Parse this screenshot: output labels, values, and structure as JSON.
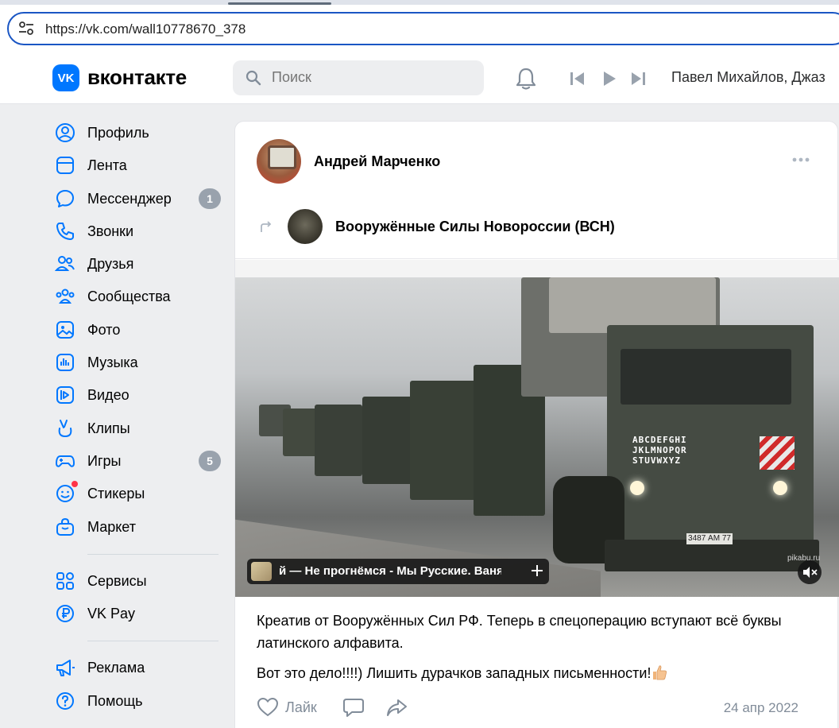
{
  "browser": {
    "url": "https://vk.com/wall10778670_378"
  },
  "header": {
    "logo_text": "VK",
    "brand": "вконтакте",
    "search_placeholder": "Поиск",
    "now_playing": "Павел Михайлов, Джаз"
  },
  "sidebar": {
    "items": [
      {
        "label": "Профиль",
        "icon": "profile-icon"
      },
      {
        "label": "Лента",
        "icon": "feed-icon"
      },
      {
        "label": "Мессенджер",
        "icon": "messenger-icon",
        "badge": "1"
      },
      {
        "label": "Звонки",
        "icon": "phone-icon"
      },
      {
        "label": "Друзья",
        "icon": "friends-icon"
      },
      {
        "label": "Сообщества",
        "icon": "communities-icon"
      },
      {
        "label": "Фото",
        "icon": "photo-icon"
      },
      {
        "label": "Музыка",
        "icon": "music-icon"
      },
      {
        "label": "Видео",
        "icon": "video-icon"
      },
      {
        "label": "Клипы",
        "icon": "clips-icon"
      },
      {
        "label": "Игры",
        "icon": "games-icon",
        "badge": "5"
      },
      {
        "label": "Стикеры",
        "icon": "stickers-icon"
      },
      {
        "label": "Маркет",
        "icon": "market-icon"
      }
    ],
    "extra": [
      {
        "label": "Сервисы",
        "icon": "services-icon"
      },
      {
        "label": "VK Pay",
        "icon": "vkpay-icon"
      }
    ],
    "bottom": [
      {
        "label": "Реклама",
        "icon": "ads-icon"
      },
      {
        "label": "Помощь",
        "icon": "help-icon"
      }
    ]
  },
  "post": {
    "author": "Андрей Марченко",
    "repost_group": "Вооружённые Силы Новороссии (ВСН)",
    "truck_letters": [
      "ABCDEFGHI",
      "JKLMNOPQR",
      "STUVWXYZ"
    ],
    "plate": "3487 АМ 77",
    "watermark": "pikabu.ru",
    "audio_title": "й — Не прогнёмся - Мы Русские.   Ваня",
    "text_1": "Креатив от Вооружённых Сил РФ. Теперь в спецоперацию вступают всё буквы латинского алфавита.",
    "text_2": "Вот это дело!!!!) Лишить дурачков западных письменности!",
    "like_label": "Лайк",
    "date": "24 апр 2022"
  },
  "colors": {
    "accent": "#0077ff",
    "badge": "#99a2ad",
    "muted": "#818c99"
  }
}
